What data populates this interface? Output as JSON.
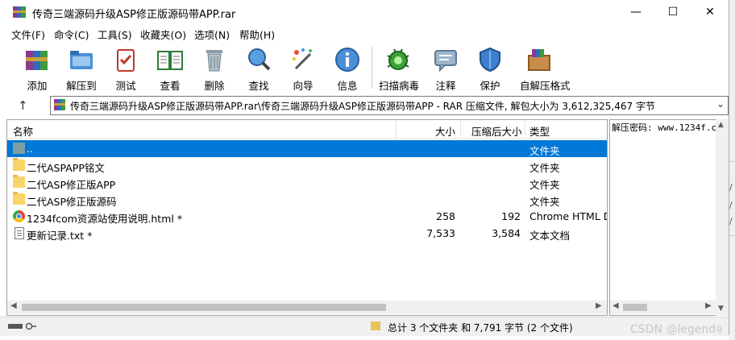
{
  "window": {
    "title": "传奇三端源码升级ASP修正版源码带APP.rar",
    "minimize": "—",
    "maximize": "☐",
    "close": "✕"
  },
  "menu": [
    "文件(F)",
    "命令(C)",
    "工具(S)",
    "收藏夹(O)",
    "选项(N)",
    "帮助(H)"
  ],
  "toolbar": [
    {
      "label": "添加",
      "icon": "add-archive-icon"
    },
    {
      "label": "解压到",
      "icon": "extract-to-icon"
    },
    {
      "label": "测试",
      "icon": "test-icon"
    },
    {
      "label": "查看",
      "icon": "view-icon"
    },
    {
      "label": "删除",
      "icon": "delete-icon"
    },
    {
      "label": "查找",
      "icon": "find-icon"
    },
    {
      "label": "向导",
      "icon": "wizard-icon"
    },
    {
      "label": "信息",
      "icon": "info-icon"
    },
    {
      "label": "扫描病毒",
      "icon": "virus-scan-icon"
    },
    {
      "label": "注释",
      "icon": "comment-icon"
    },
    {
      "label": "保护",
      "icon": "protect-icon"
    },
    {
      "label": "自解压格式",
      "icon": "sfx-icon"
    }
  ],
  "address": {
    "up": "↑",
    "path": "传奇三端源码升级ASP修正版源码带APP.rar\\传奇三端源码升级ASP修正版源码带APP - RAR 压缩文件, 解包大小为 3,612,325,467 字节",
    "dropdown": "⌄"
  },
  "columns": {
    "name": "名称",
    "size": "大小",
    "packed": "压缩后大小",
    "type": "类型",
    "sort_caret": "^"
  },
  "files": [
    {
      "name": "..",
      "size": "",
      "packed": "",
      "type": "文件夹",
      "kind": "parent",
      "selected": true
    },
    {
      "name": "二代ASPAPP铭文",
      "size": "",
      "packed": "",
      "type": "文件夹",
      "kind": "folder",
      "selected": false
    },
    {
      "name": "二代ASP修正版APP",
      "size": "",
      "packed": "",
      "type": "文件夹",
      "kind": "folder",
      "selected": false
    },
    {
      "name": "二代ASP修正版源码",
      "size": "",
      "packed": "",
      "type": "文件夹",
      "kind": "folder",
      "selected": false
    },
    {
      "name": "1234fcom资源站使用说明.html *",
      "size": "258",
      "packed": "192",
      "type": "Chrome HTML D",
      "kind": "chrome",
      "selected": false
    },
    {
      "name": "更新记录.txt *",
      "size": "7,533",
      "packed": "3,584",
      "type": "文本文档",
      "kind": "txt",
      "selected": false
    }
  ],
  "comment": "解压密码: www.1234f.c",
  "status": {
    "summary": "总计 3 个文件夹 和 7,791 字节 (2 个文件)"
  },
  "watermark": "CSDN @legendจ",
  "colors": {
    "selection": "#0078d7",
    "folder": "#f8d56b"
  }
}
